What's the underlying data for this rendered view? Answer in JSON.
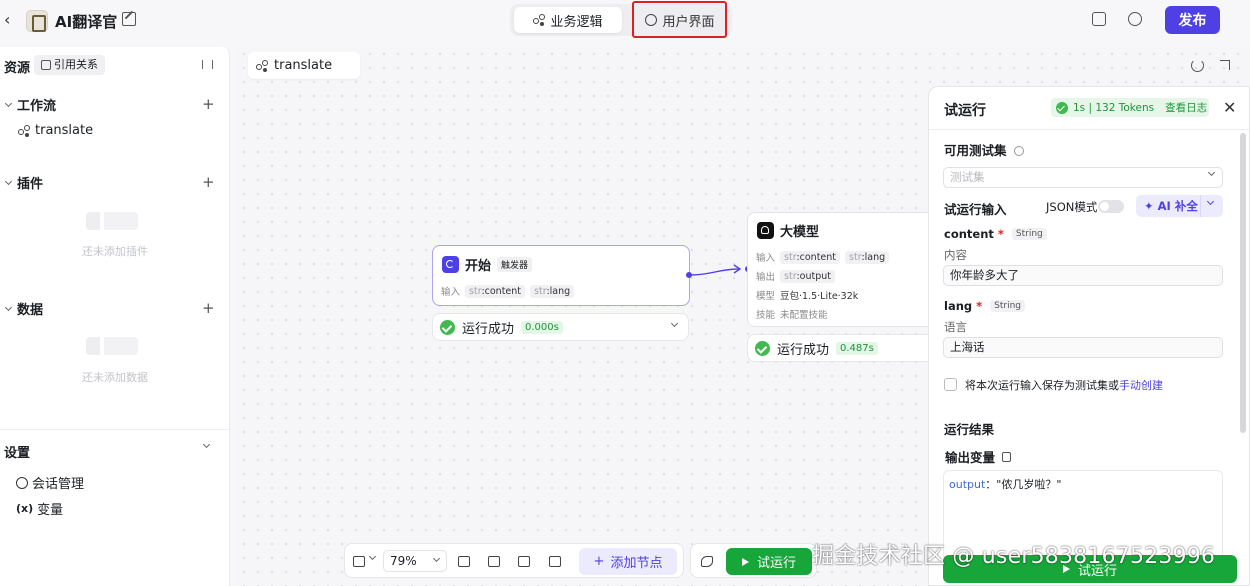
{
  "header": {
    "app_title": "AI翻译官",
    "tabs": [
      {
        "label": "业务逻辑",
        "active": true
      },
      {
        "label": "用户界面",
        "active": false
      }
    ],
    "publish_label": "发布"
  },
  "sidebar": {
    "resources_label": "资源",
    "references_label": "引用关系",
    "sections": [
      {
        "title": "工作流",
        "items": [
          "translate"
        ],
        "empty_text": ""
      },
      {
        "title": "插件",
        "items": [],
        "empty_text": "还未添加插件"
      },
      {
        "title": "数据",
        "items": [],
        "empty_text": "还未添加数据"
      }
    ],
    "settings": {
      "title": "设置",
      "items": [
        {
          "label": "会话管理",
          "icon": "chat-icon"
        },
        {
          "label": "变量",
          "icon": "variable-icon"
        }
      ]
    }
  },
  "canvas": {
    "breadcrumb": "translate",
    "start_node": {
      "title": "开始",
      "tag": "触发器",
      "row_label": "输入",
      "inputs": [
        {
          "type": "str",
          "name": "content"
        },
        {
          "type": "str",
          "name": "lang"
        }
      ],
      "status": "运行成功",
      "time": "0.000s"
    },
    "llm_node": {
      "title": "大模型",
      "input_label": "输入",
      "inputs": [
        {
          "type": "str",
          "name": "content"
        },
        {
          "type": "str",
          "name": "lang"
        }
      ],
      "output_label": "输出",
      "outputs": [
        {
          "type": "str",
          "name": "output"
        }
      ],
      "model_label": "模型",
      "model": "豆包·1.5·Lite·32k",
      "skill_label": "技能",
      "skill": "未配置技能",
      "status": "运行成功",
      "time": "0.487s"
    }
  },
  "toolbar": {
    "zoom": "79%",
    "add_node_label": "添加节点",
    "run_label": "试运行"
  },
  "panel": {
    "title": "试运行",
    "badge": "1s | 132 Tokens",
    "log_link": "查看日志",
    "test_set_label": "可用测试集",
    "test_set_placeholder": "测试集",
    "input_label": "试运行输入",
    "json_mode_label": "JSON模式",
    "ai_fill_label": "AI 补全",
    "fields": [
      {
        "name": "content",
        "type": "String",
        "desc": "内容",
        "value": "你年龄多大了"
      },
      {
        "name": "lang",
        "type": "String",
        "desc": "语言",
        "value": "上海话"
      }
    ],
    "save_text": "将本次运行输入保存为测试集或",
    "save_link": "手动创建",
    "result_label": "运行结果",
    "output_label": "输出变量",
    "output_key": "output",
    "output_value": "\"侬几岁啦？\"",
    "run_label": "试运行"
  },
  "watermark": "掘金技术社区 @ user5838167523996"
}
